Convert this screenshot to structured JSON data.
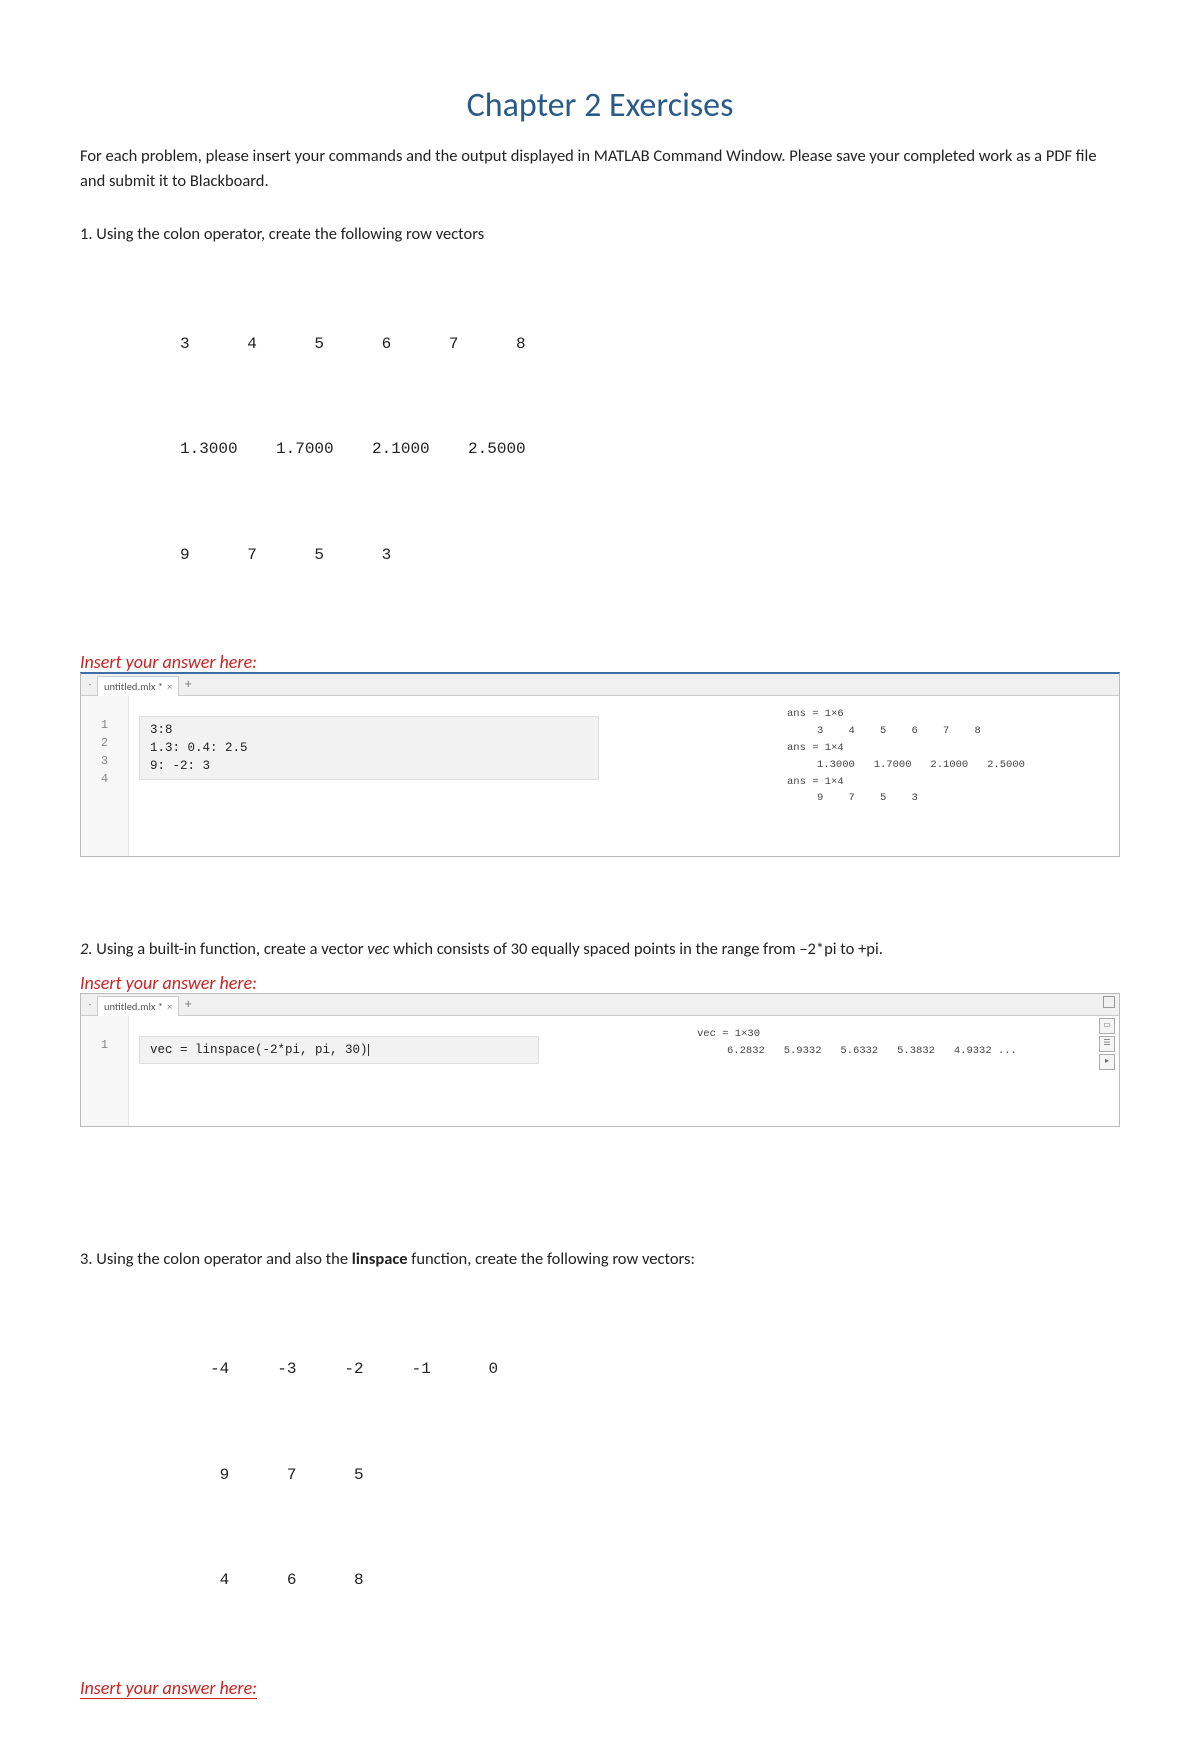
{
  "title": "Chapter 2 Exercises",
  "intro": "For each problem, please insert your commands and the output displayed in MATLAB Command Window. Please save your completed work as a PDF file and submit it to Blackboard.",
  "answer_label": "Insert your answer here:",
  "problems": {
    "p1": {
      "text": "1. Using the colon operator, create the following row vectors",
      "rows": [
        "3      4      5      6      7      8",
        "1.3000    1.7000    2.1000    2.5000",
        "9      7      5      3"
      ]
    },
    "p2": {
      "prefix": "2.",
      "text_a": " Using a built-in func",
      "text_b": "on, create a vector ",
      "vec": "vec",
      "text_c": " which consists of 30 equally spaced points in the range from –2*pi to +pi."
    },
    "p3": {
      "text_a": "3. Using the colon operator and also the ",
      "bold": "linspace",
      "text_b": " func",
      "text_c": "on, create the following row vectors:",
      "rows": [
        "-4     -3     -2     -1      0",
        " 9      7      5",
        " 4      6      8"
      ]
    }
  },
  "matlab1": {
    "tab": "untitled.mlx *",
    "lines": [
      "1",
      "2",
      "3",
      "4"
    ],
    "code": [
      "3:8",
      "1.3: 0.4: 2.5",
      "9: -2: 3"
    ],
    "output": {
      "h1": "ans = 1×6",
      "r1": "3    4    5    6    7    8",
      "h2": "ans = 1×4",
      "r2": "1.3000   1.7000   2.1000   2.5000",
      "h3": "ans = 1×4",
      "r3": "9    7    5    3"
    }
  },
  "matlab2": {
    "tab": "untitled.mlx *",
    "lines": [
      "1"
    ],
    "code": [
      "vec = linspace(-2*pi, pi, 30)"
    ],
    "output": {
      "h1": "vec = 1×30",
      "r1": "6.2832   5.9332   5.6332   5.3832   4.9332 ..."
    }
  }
}
